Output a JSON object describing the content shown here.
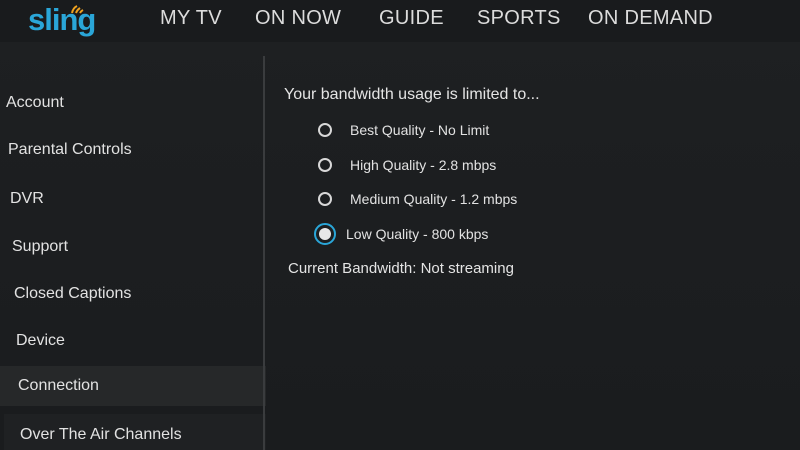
{
  "header": {
    "logo_text": "sling",
    "nav": [
      "MY TV",
      "ON NOW",
      "GUIDE",
      "SPORTS",
      "ON DEMAND"
    ]
  },
  "sidebar": {
    "items": [
      {
        "label": "Account"
      },
      {
        "label": "Parental Controls"
      },
      {
        "label": "DVR"
      },
      {
        "label": "Support"
      },
      {
        "label": "Closed Captions"
      },
      {
        "label": "Device"
      },
      {
        "label": "Connection",
        "selected": true
      },
      {
        "label": "Over The Air Channels"
      }
    ]
  },
  "main": {
    "heading": "Your bandwidth usage is limited to...",
    "options": [
      {
        "label": "Best Quality - No Limit",
        "checked": false
      },
      {
        "label": "High Quality - 2.8 mbps",
        "checked": false
      },
      {
        "label": "Medium Quality - 1.2 mbps",
        "checked": false
      },
      {
        "label": "Low Quality - 800 kbps",
        "checked": true
      }
    ],
    "current_bandwidth": "Current Bandwidth: Not streaming"
  },
  "colors": {
    "accent": "#2aa6d8",
    "background": "#1c1e20",
    "text": "#e2e2e2"
  }
}
